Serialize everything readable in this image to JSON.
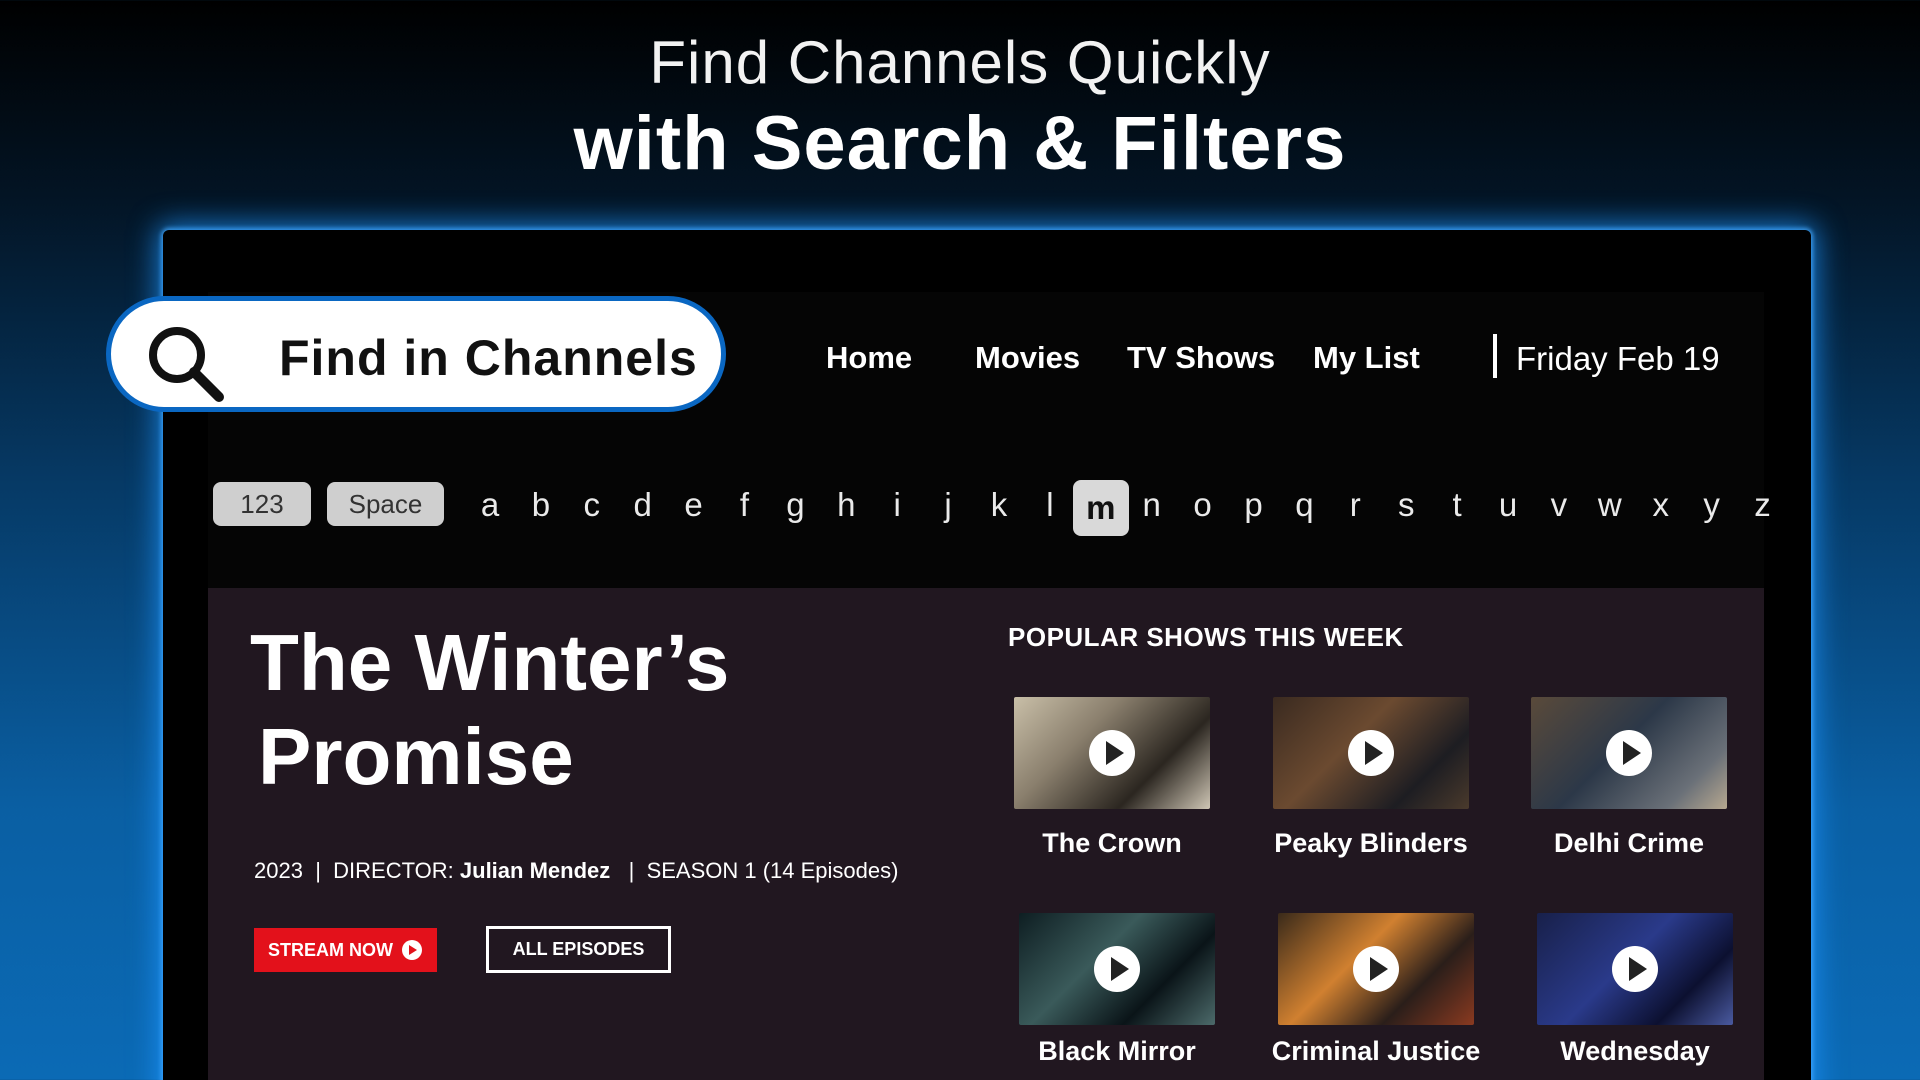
{
  "headline": {
    "line1": "Find Channels Quickly",
    "line2": "with Search & Filters"
  },
  "search": {
    "placeholder": "Find in Channels",
    "icon": "search-icon"
  },
  "nav": {
    "items": [
      "Home",
      "Movies",
      "TV Shows",
      "My List"
    ],
    "date": "Friday Feb 19"
  },
  "keyboard": {
    "num_key": "123",
    "space_key": "Space",
    "letters": [
      "a",
      "b",
      "c",
      "d",
      "e",
      "f",
      "g",
      "h",
      "i",
      "j",
      "k",
      "l",
      "m",
      "n",
      "o",
      "p",
      "q",
      "r",
      "s",
      "t",
      "u",
      "v",
      "w",
      "x",
      "y",
      "z"
    ],
    "selected": "m"
  },
  "featured": {
    "title_line1": "The Winter’s",
    "title_line2": "Promise",
    "year": "2023",
    "director_label": "DIRECTOR:",
    "director": "Julian Mendez",
    "season": "SEASON 1 (14 Episodes)",
    "stream_label": "STREAM NOW",
    "episodes_label": "ALL EPISODES"
  },
  "popular": {
    "heading": "POPULAR SHOWS THIS WEEK",
    "shows": [
      {
        "name": "The Crown"
      },
      {
        "name": "Peaky Blinders"
      },
      {
        "name": "Delhi Crime"
      },
      {
        "name": "Black Mirror"
      },
      {
        "name": "Criminal Justice"
      },
      {
        "name": "Wednesday"
      }
    ]
  },
  "colors": {
    "accent_red": "#e3111b",
    "glow_blue": "#1e96ff",
    "panel": "#211720"
  }
}
